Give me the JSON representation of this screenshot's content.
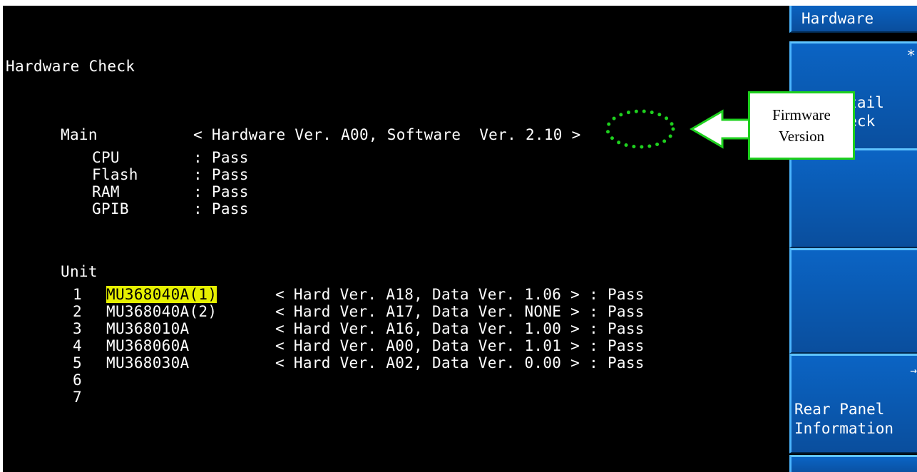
{
  "title": "Hardware Check",
  "main": {
    "label": "Main",
    "version_text": "< Hardware Ver. A00, Software  Ver. 2.10 >",
    "checks": [
      {
        "name": "CPU",
        "result": ": Pass"
      },
      {
        "name": "Flash",
        "result": ": Pass"
      },
      {
        "name": "RAM",
        "result": ": Pass"
      },
      {
        "name": "GPIB",
        "result": ": Pass"
      }
    ]
  },
  "unit": {
    "label": "Unit",
    "rows": [
      {
        "num": "1",
        "name": "MU368040A(1)",
        "info": "< Hard Ver. A18, Data Ver. 1.06 > : Pass",
        "selected": true
      },
      {
        "num": "2",
        "name": "MU368040A(2)",
        "info": "< Hard Ver. A17, Data Ver. NONE > : Pass"
      },
      {
        "num": "3",
        "name": "MU368010A",
        "info": "< Hard Ver. A16, Data Ver. 1.00 > : Pass"
      },
      {
        "num": "4",
        "name": "MU368060A",
        "info": "< Hard Ver. A00, Data Ver. 1.01 > : Pass"
      },
      {
        "num": "5",
        "name": "MU368030A",
        "info": "< Hard Ver. A02, Data Ver. 0.00 > : Pass"
      },
      {
        "num": "6",
        "name": "",
        "info": ""
      },
      {
        "num": "7",
        "name": "",
        "info": ""
      }
    ]
  },
  "softkeys": {
    "header": "Hardware",
    "detail_label_line1": "Detail",
    "detail_label_line2": "Check",
    "detail_marker": "*",
    "rear_arrow": "→",
    "rear_label_line1": "Rear Panel",
    "rear_label_line2": "Information"
  },
  "annotation": {
    "line1": "Firmware",
    "line2": "Version",
    "color": "#1ed01e"
  },
  "colors": {
    "screen_bg": "#000000",
    "text": "#ffffff",
    "highlight": "#e6f000",
    "softkey": "#0a57ad"
  }
}
